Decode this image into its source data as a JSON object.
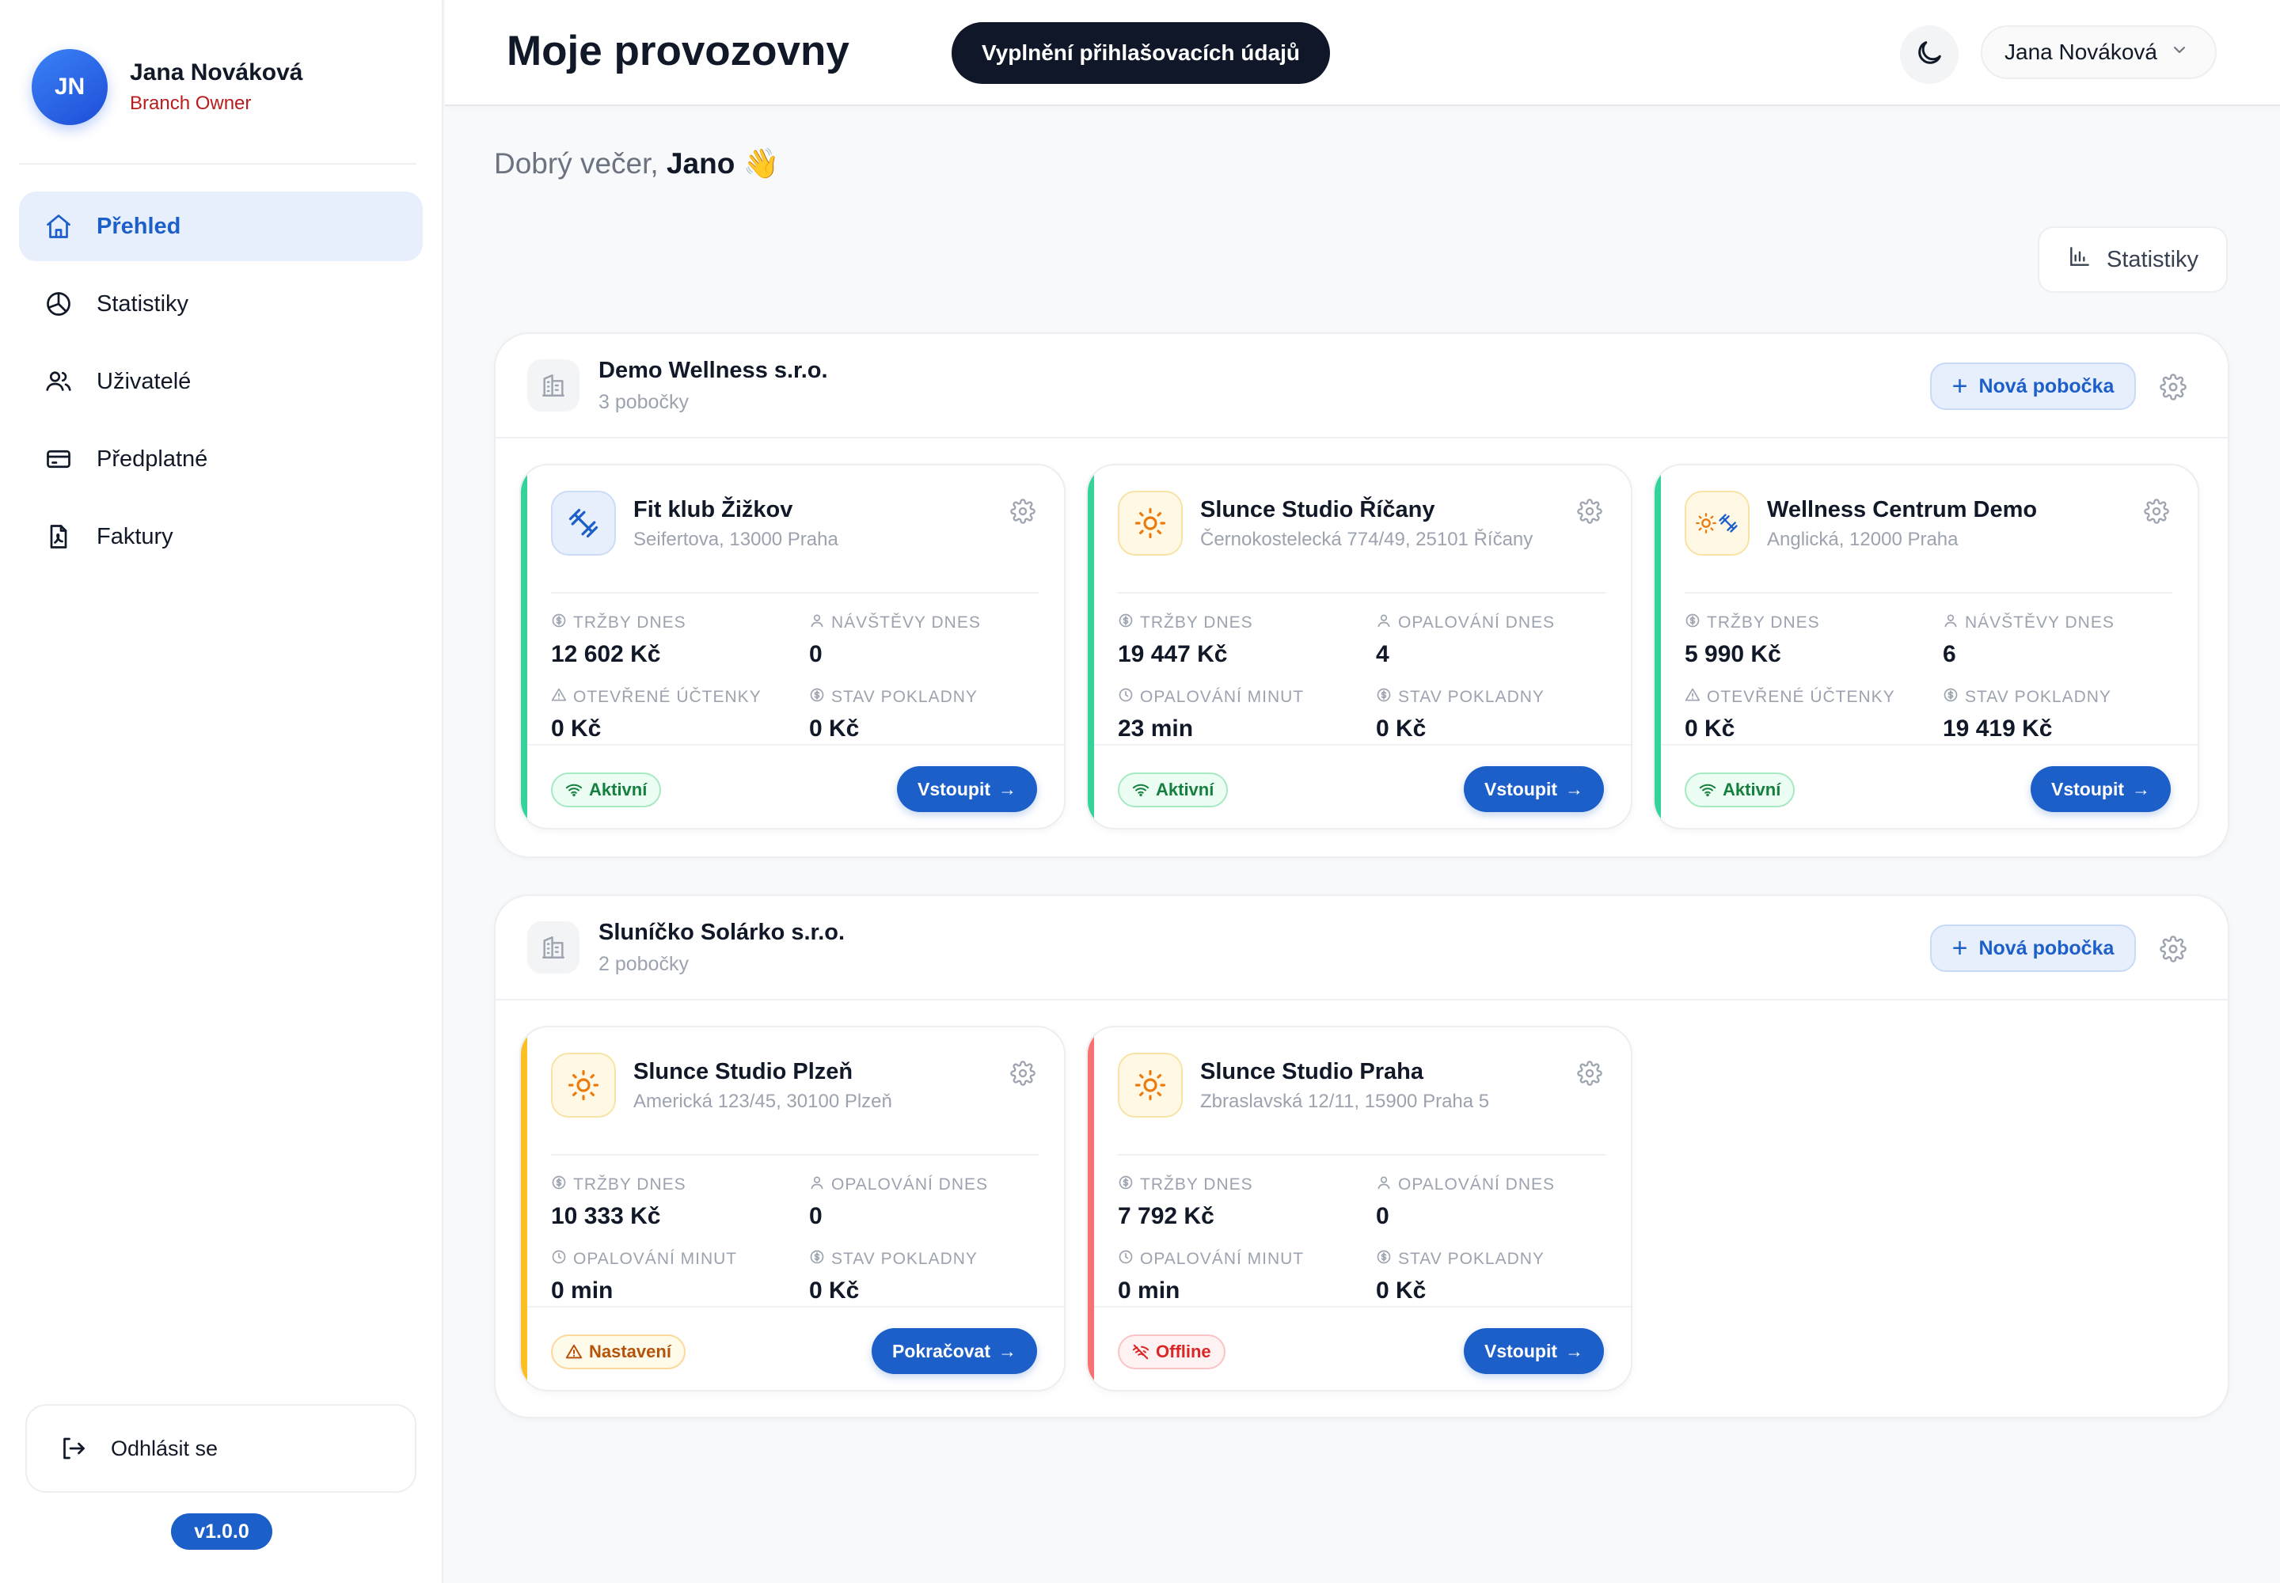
{
  "profile": {
    "initials": "JN",
    "name": "Jana Nováková",
    "role": "Branch Owner"
  },
  "nav": [
    {
      "label": "Přehled",
      "icon": "home-icon",
      "active": true
    },
    {
      "label": "Statistiky",
      "icon": "pie-chart-icon"
    },
    {
      "label": "Uživatelé",
      "icon": "users-icon"
    },
    {
      "label": "Předplatné",
      "icon": "credit-card-icon"
    },
    {
      "label": "Faktury",
      "icon": "invoice-icon"
    }
  ],
  "logout_label": "Odhlásit se",
  "version": "v1.0.0",
  "header": {
    "title": "Moje provozovny",
    "credentials_button": "Vyplnění přihlašovacích údajů",
    "user_menu": "Jana Nováková"
  },
  "greeting": {
    "prefix": "Dobrý večer,",
    "name": "Jano",
    "emoji": "👋"
  },
  "stats_button": "Statistiky",
  "add_branch_label": "Nová pobočka",
  "groups": [
    {
      "name": "Demo Wellness s.r.o.",
      "count": "3 pobočky",
      "branches": [
        {
          "name": "Fit klub Žižkov",
          "address": "Seifertova, 13000 Praha",
          "icon": "dumbbell-icon",
          "accent": "#34d399",
          "metrics": [
            {
              "label": "TRŽBY DNES",
              "value": "12 602 Kč"
            },
            {
              "label": "NÁVŠTĚVY DNES",
              "value": "0"
            },
            {
              "label": "OTEVŘENÉ ÚČTENKY",
              "value": "0 Kč"
            },
            {
              "label": "STAV POKLADNY",
              "value": "0 Kč"
            }
          ],
          "status": "Aktivní",
          "action": "Vstoupit"
        },
        {
          "name": "Slunce Studio Říčany",
          "address": "Černokostelecká 774/49, 25101 Říčany",
          "icon": "sun-icon",
          "accent": "#34d399",
          "metrics": [
            {
              "label": "TRŽBY DNES",
              "value": "19 447 Kč"
            },
            {
              "label": "OPALOVÁNÍ DNES",
              "value": "4"
            },
            {
              "label": "OPALOVÁNÍ MINUT",
              "value": "23 min"
            },
            {
              "label": "STAV POKLADNY",
              "value": "0 Kč"
            }
          ],
          "status": "Aktivní",
          "action": "Vstoupit"
        },
        {
          "name": "Wellness Centrum Demo",
          "address": "Anglická, 12000 Praha",
          "icon": "sun-dumbbell-icon",
          "accent": "#34d399",
          "metrics": [
            {
              "label": "TRŽBY DNES",
              "value": "5 990 Kč"
            },
            {
              "label": "NÁVŠTĚVY DNES",
              "value": "6"
            },
            {
              "label": "OTEVŘENÉ ÚČTENKY",
              "value": "0 Kč"
            },
            {
              "label": "STAV POKLADNY",
              "value": "19 419 Kč"
            }
          ],
          "status": "Aktivní",
          "action": "Vstoupit"
        }
      ]
    },
    {
      "name": "Sluníčko Solárko s.r.o.",
      "count": "2 pobočky",
      "branches": [
        {
          "name": "Slunce Studio Plzeň",
          "address": "Americká 123/45, 30100 Plzeň",
          "icon": "sun-icon",
          "accent": "#fbbf24",
          "metrics": [
            {
              "label": "TRŽBY DNES",
              "value": "10 333 Kč"
            },
            {
              "label": "OPALOVÁNÍ DNES",
              "value": "0"
            },
            {
              "label": "OPALOVÁNÍ MINUT",
              "value": "0 min"
            },
            {
              "label": "STAV POKLADNY",
              "value": "0 Kč"
            }
          ],
          "status": "Nastavení",
          "action": "Pokračovat"
        },
        {
          "name": "Slunce Studio Praha",
          "address": "Zbraslavská 12/11, 15900 Praha 5",
          "icon": "sun-icon",
          "accent": "#f87171",
          "metrics": [
            {
              "label": "TRŽBY DNES",
              "value": "7 792 Kč"
            },
            {
              "label": "OPALOVÁNÍ DNES",
              "value": "0"
            },
            {
              "label": "OPALOVÁNÍ MINUT",
              "value": "0 min"
            },
            {
              "label": "STAV POKLADNY",
              "value": "0 Kč"
            }
          ],
          "status": "Offline",
          "action": "Vstoupit"
        }
      ]
    }
  ]
}
